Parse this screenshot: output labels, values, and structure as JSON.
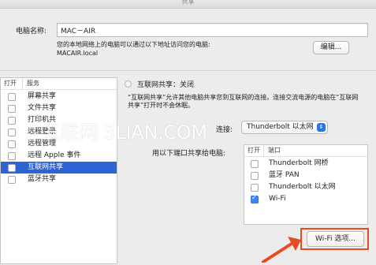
{
  "window": {
    "title": "共享"
  },
  "computer_name": {
    "label": "电脑名称:",
    "value": "MAC－AIR",
    "desc_line1": "您的本地网络上的电脑可以通过以下地址访问您的电脑:",
    "desc_line2": "MACAIR.local",
    "edit_button": "编辑..."
  },
  "services": {
    "header_on": "打开",
    "header_service": "服务",
    "items": [
      {
        "label": "屏幕共享",
        "checked": false,
        "selected": false
      },
      {
        "label": "文件共享",
        "checked": false,
        "selected": false
      },
      {
        "label": "打印机共",
        "checked": false,
        "selected": false
      },
      {
        "label": "远程登录",
        "checked": false,
        "selected": false
      },
      {
        "label": "远程管理",
        "checked": false,
        "selected": false
      },
      {
        "label": "远程 Apple 事件",
        "checked": false,
        "selected": false
      },
      {
        "label": "互联网共享",
        "checked": false,
        "selected": true
      },
      {
        "label": "蓝牙共享",
        "checked": false,
        "selected": false
      }
    ]
  },
  "internet_sharing": {
    "status": "互联网共享：关闭",
    "description_line1": "“互联网共享”允许其他电脑共享您到互联网的连接。连接交流电源的电脑在“互联网",
    "description_line2": "共享”打开时不会休眠。",
    "connection_label": "连接:",
    "connection_value": "Thunderbolt 以太网",
    "ports_label": "用以下端口共享给电脑:",
    "ports_header_on": "打开",
    "ports_header_port": "端口",
    "ports": [
      {
        "label": "Thunderbolt 网桥",
        "checked": false
      },
      {
        "label": "蓝牙 PAN",
        "checked": false
      },
      {
        "label": "Thunderbolt 以太网",
        "checked": false
      },
      {
        "label": "Wi-Fi",
        "checked": true
      }
    ],
    "wifi_options_button": "Wi-Fi 选项..."
  },
  "watermark": "三联网 3LIAN.COM",
  "colors": {
    "selection": "#2d63d2",
    "check_blue": "#3d87f5",
    "annotation_red": "#e74b25"
  }
}
